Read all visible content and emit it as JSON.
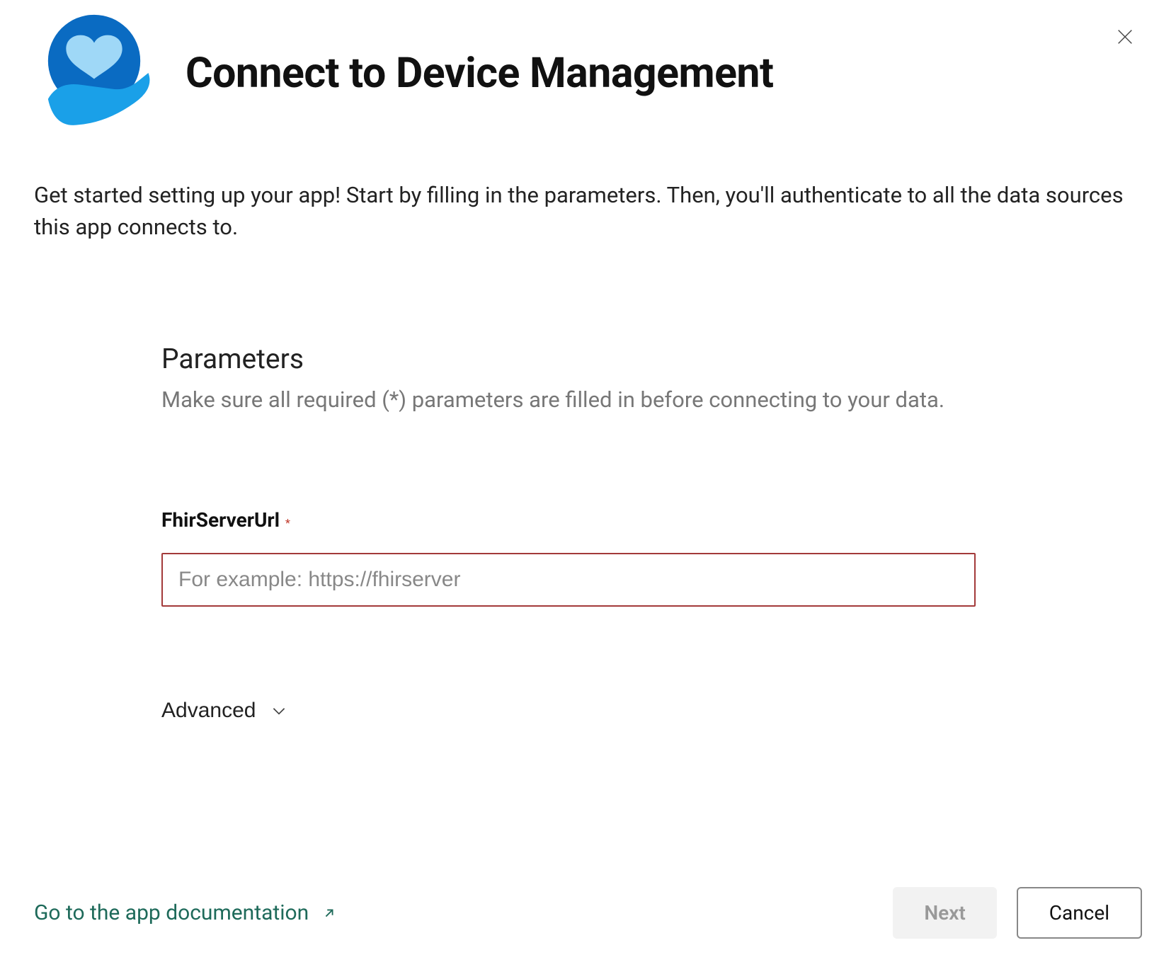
{
  "dialog": {
    "title": "Connect to Device Management",
    "intro": "Get started setting up your app! Start by filling in the parameters. Then, you'll authenticate to all the data sources this app connects to."
  },
  "parameters": {
    "heading": "Parameters",
    "description": "Make sure all required (*) parameters are filled in before connecting to your data.",
    "fields": {
      "fhir": {
        "label": "FhirServerUrl",
        "required_marker": "*",
        "placeholder": "For example: https://fhirserver",
        "value": ""
      }
    },
    "advanced_label": "Advanced"
  },
  "footer": {
    "doc_link_label": "Go to the app documentation",
    "next_label": "Next",
    "cancel_label": "Cancel"
  },
  "icons": {
    "close": "close-icon",
    "logo": "health-hand-heart-logo",
    "chevron_down": "chevron-down-icon",
    "external": "external-link-icon"
  }
}
